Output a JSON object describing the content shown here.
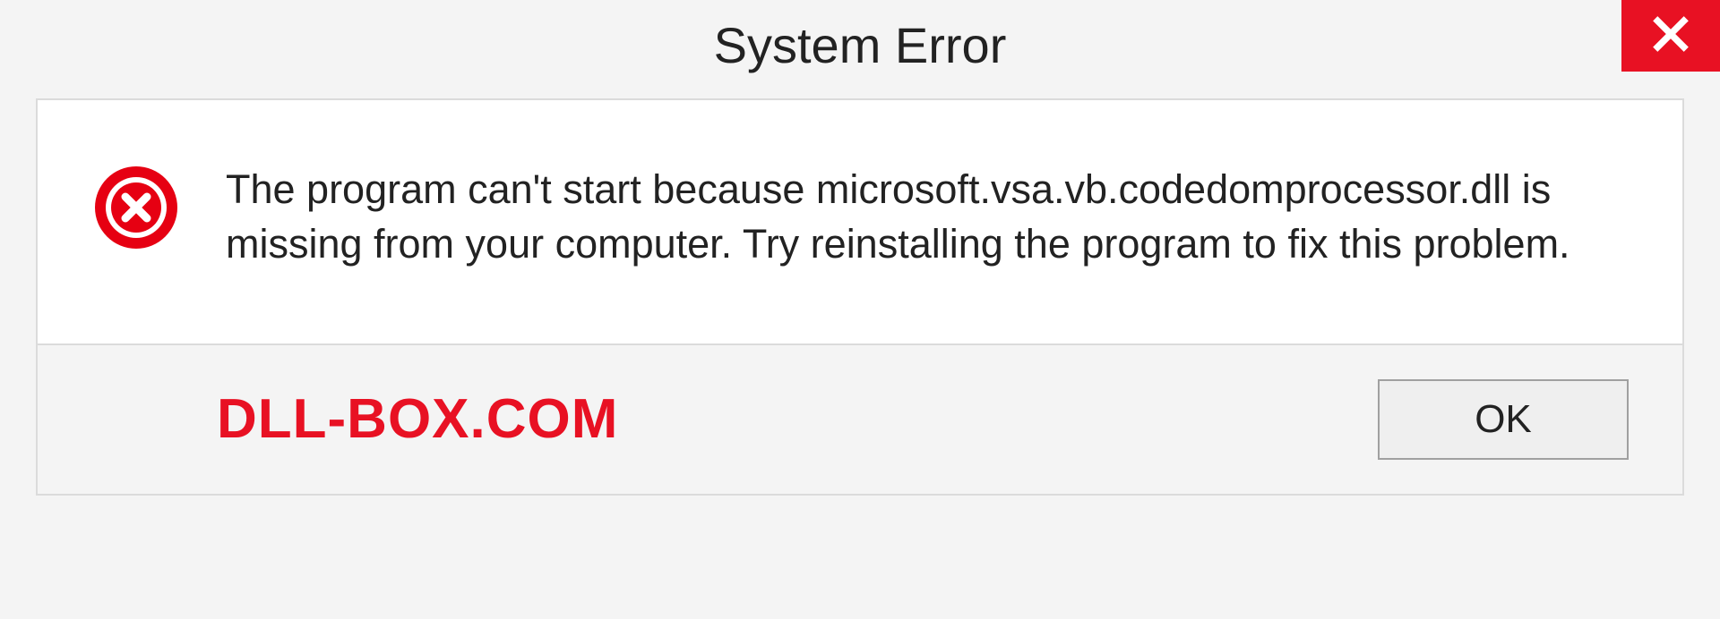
{
  "window": {
    "title": "System Error"
  },
  "content": {
    "message": "The program can't start because microsoft.vsa.vb.codedomprocessor.dll is missing from your computer. Try reinstalling the program to fix this problem."
  },
  "footer": {
    "brand": "DLL-BOX.COM",
    "ok_label": "OK"
  },
  "colors": {
    "accent_red": "#e81123",
    "text": "#222222",
    "panel_bg": "#ffffff",
    "window_bg": "#f4f4f4",
    "border": "#dbdbdb"
  }
}
